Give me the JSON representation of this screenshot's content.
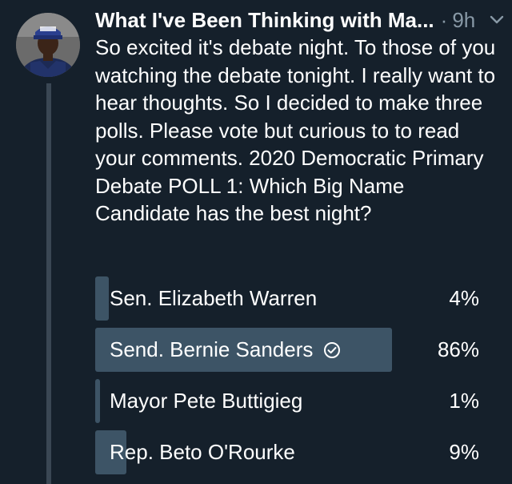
{
  "author": {
    "name": "What I've Been Thinking with Ma...",
    "separator": "·",
    "time": "9h",
    "menu_icon": "chevron-down-icon"
  },
  "tweet": {
    "text": "So excited it's debate night. To those of you watching the debate tonight. I really want to hear thoughts. So I decided to make three polls. Please vote but curious to to read your comments. 2020 Democratic Primary Debate POLL 1: Which Big Name Candidate has the best night?"
  },
  "poll": {
    "options": [
      {
        "label": "Sen. Elizabeth Warren",
        "percent": "4%",
        "fraction": 0.04,
        "selected": false
      },
      {
        "label": "Send. Bernie Sanders",
        "percent": "86%",
        "fraction": 0.86,
        "selected": true
      },
      {
        "label": "Mayor Pete Buttigieg",
        "percent": "1%",
        "fraction": 0.01,
        "selected": false
      },
      {
        "label": "Rep. Beto O'Rourke",
        "percent": "9%",
        "fraction": 0.09,
        "selected": false
      }
    ]
  },
  "colors": {
    "background": "#15202b",
    "bar": "#3d5466",
    "muted": "#8899a6"
  }
}
